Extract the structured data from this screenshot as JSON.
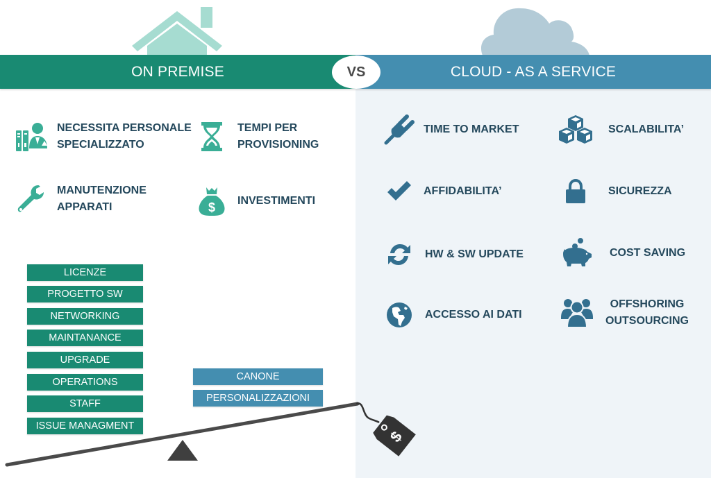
{
  "header": {
    "left_title": "ON PREMISE",
    "vs_label": "VS",
    "right_title": "CLOUD - AS A SERVICE"
  },
  "colors": {
    "on_premise": "#198a72",
    "cloud": "#448eb0",
    "on_premise_icon": "#3aae96",
    "cloud_icon": "#336f8f",
    "text_dark": "#24485c",
    "right_panel_bg": "#eff4f8"
  },
  "on_premise": {
    "header_icon": "house-icon",
    "features": [
      {
        "icon": "specialist-staff-icon",
        "label": "NECESSITA PERSONALE\nSPECIALIZZATO"
      },
      {
        "icon": "hourglass-icon",
        "label": "TEMPI PER\nPROVISIONING"
      },
      {
        "icon": "wrench-icon",
        "label": "MANUTENZIONE\nAPPARATI"
      },
      {
        "icon": "money-bag-icon",
        "label": "INVESTIMENTI"
      }
    ],
    "cost_items": [
      "LICENZE",
      "PROGETTO SW",
      "NETWORKING",
      "MAINTANANCE",
      "UPGRADE",
      "OPERATIONS",
      "STAFF",
      "ISSUE MANAGMENT"
    ]
  },
  "cloud": {
    "header_icon": "cloud-icon",
    "features": [
      {
        "icon": "plug-icon",
        "label": "TIME TO MARKET"
      },
      {
        "icon": "cubes-icon",
        "label": "SCALABILITA’"
      },
      {
        "icon": "checkmark-icon",
        "label": "AFFIDABILITA’"
      },
      {
        "icon": "lock-icon",
        "label": "SICUREZZA"
      },
      {
        "icon": "refresh-icon",
        "label": "HW & SW UPDATE"
      },
      {
        "icon": "piggy-bank-icon",
        "label": "COST SAVING"
      },
      {
        "icon": "globe-icon",
        "label": "ACCESSO AI DATI"
      },
      {
        "icon": "users-group-icon",
        "label": "OFFSHORING\nOUTSOURCING"
      }
    ],
    "cost_items": [
      "CANONE",
      "PERSONALIZZAZIONI"
    ]
  },
  "scale": {
    "price_tag_symbol": "$"
  }
}
